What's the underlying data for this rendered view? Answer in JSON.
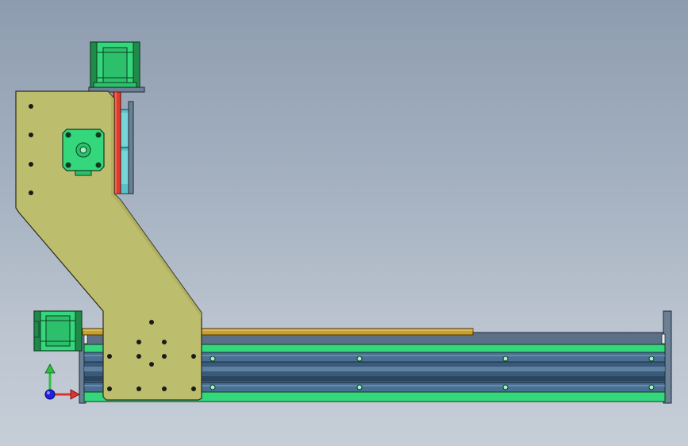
{
  "viewport": {
    "view_name": "cad-model-viewport",
    "colors": {
      "background_top": "#8d9caf",
      "background_bottom": "#c6ced8",
      "plate": "#bdbd6e",
      "plate_outline": "#2b2b1a",
      "motor_green": "#34d77b",
      "motor_dark": "#1f8a4a",
      "rail_green": "#34d77b",
      "rail_blue": "#4a6f92",
      "rail_blue_dark": "#2c4a66",
      "lead_screw": "#c9a030",
      "z_screw": "#e03a2a",
      "z_block": "#57c2c9",
      "hole": "#1a1a1a",
      "bolt_green": "#9ff5c1"
    },
    "triad": {
      "x_axis_color": "#e03030",
      "y_axis_color": "#30c040",
      "z_axis_color": "#2020e0"
    }
  }
}
